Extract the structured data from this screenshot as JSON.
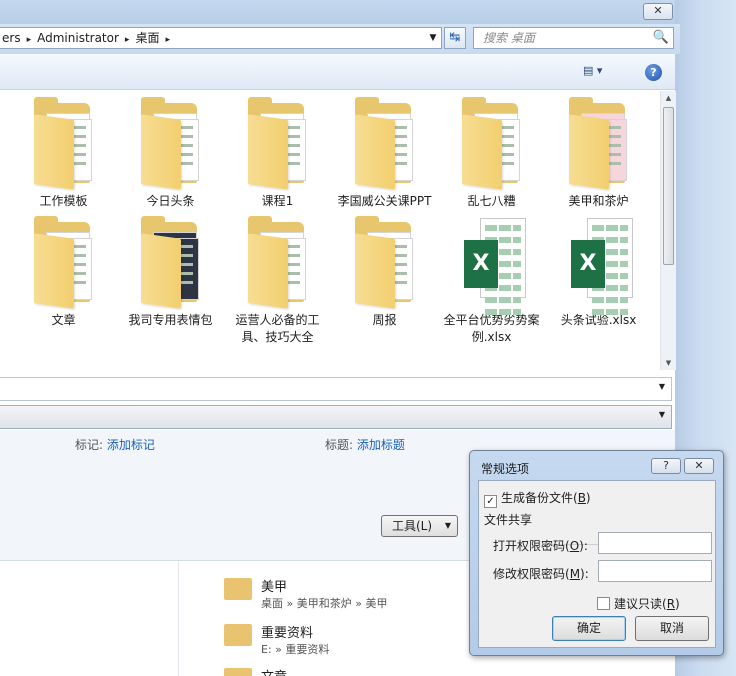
{
  "window": {
    "close_label": "✕"
  },
  "address": {
    "crumbs": [
      "ers",
      "Administrator",
      "桌面"
    ],
    "separator": "▸",
    "dropdown": "▼"
  },
  "refresh": {
    "icon": "refresh-icon",
    "glyph": "↹"
  },
  "search": {
    "placeholder": "搜索 桌面",
    "icon": "🔍"
  },
  "toolbar": {
    "view_glyph": "▤ ▾",
    "help_glyph": "?"
  },
  "files": [
    {
      "label": "工作模板",
      "kind": "folder"
    },
    {
      "label": "今日头条",
      "kind": "folder"
    },
    {
      "label": "课程1",
      "kind": "folder"
    },
    {
      "label": "李国威公关课PPT",
      "kind": "folder"
    },
    {
      "label": "乱七八糟",
      "kind": "folder"
    },
    {
      "label": "美甲和茶炉",
      "kind": "folder"
    },
    {
      "label": "文章",
      "kind": "folder"
    },
    {
      "label": "我司专用表情包",
      "kind": "folder"
    },
    {
      "label": "运营人必备的工具、技巧大全",
      "kind": "folder"
    },
    {
      "label": "周报",
      "kind": "folder"
    },
    {
      "label": "全平台优势劣势案例.xlsx",
      "kind": "xlsx"
    },
    {
      "label": "头条试验.xlsx",
      "kind": "xlsx"
    }
  ],
  "xls_badge": "X",
  "form": {
    "tags_label": "标记:",
    "tags_link": "添加标记",
    "title_label": "标题:",
    "title_link": "添加标题"
  },
  "tools_button": {
    "label": "工具(L)",
    "caret": "▼"
  },
  "recent": [
    {
      "title": "美甲",
      "path": "桌面 » 美甲和茶炉 » 美甲"
    },
    {
      "title": "重要资料",
      "path": "E: » 重要资料"
    },
    {
      "title": "文章",
      "path": ""
    }
  ],
  "dialog": {
    "title": "常规选项",
    "help_btn": "?",
    "close_btn": "✕",
    "backup_label": "生成备份文件(",
    "backup_key": "B",
    "backup_close": ")",
    "backup_checked": "✓",
    "share_group": "文件共享",
    "open_pw_label": "打开权限密码(",
    "open_pw_key": "O",
    "open_pw_close": "):",
    "modify_pw_label": "修改权限密码(",
    "modify_pw_key": "M",
    "modify_pw_close": "):",
    "readonly_label": "建议只读(",
    "readonly_key": "R",
    "readonly_close": ")",
    "ok": "确定",
    "cancel": "取消"
  },
  "colors": {
    "folder": "#e8c66d",
    "excel": "#1e7145",
    "link": "#1760c0"
  }
}
